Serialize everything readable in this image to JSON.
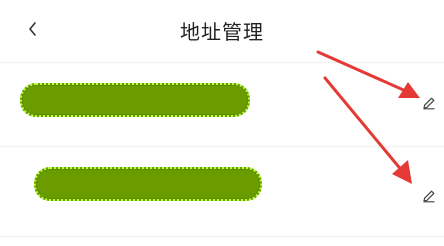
{
  "header": {
    "title": "地址管理",
    "back_icon": "chevron-left-icon"
  },
  "addresses": [
    {
      "name": "address-item-1",
      "edit_icon": "edit-pencil-icon"
    },
    {
      "name": "address-item-2",
      "edit_icon": "edit-pencil-icon"
    }
  ],
  "colors": {
    "redaction_fill": "#6a9c00",
    "redaction_border": "#b6ff3b",
    "annotation_arrow": "#e53935"
  }
}
